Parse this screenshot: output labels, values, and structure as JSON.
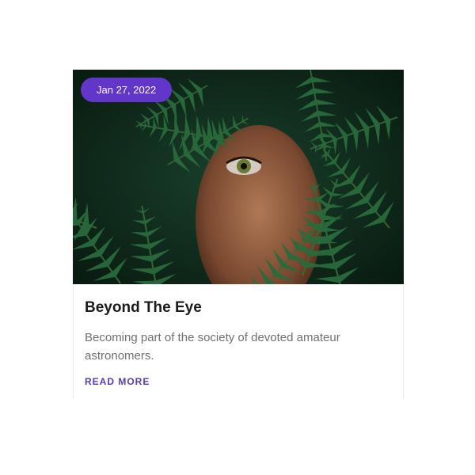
{
  "card": {
    "date": "Jan 27, 2022",
    "image_icon": "fern-eye-photo-icon",
    "title": "Beyond The Eye",
    "excerpt": "Becoming part of the society of devoted amateur astronomers.",
    "read_more": "READ MORE"
  },
  "colors": {
    "badge_bg": "#6236c8",
    "accent": "#5a3ab5",
    "title": "#1b1b1b",
    "text": "#6f6f6f"
  }
}
